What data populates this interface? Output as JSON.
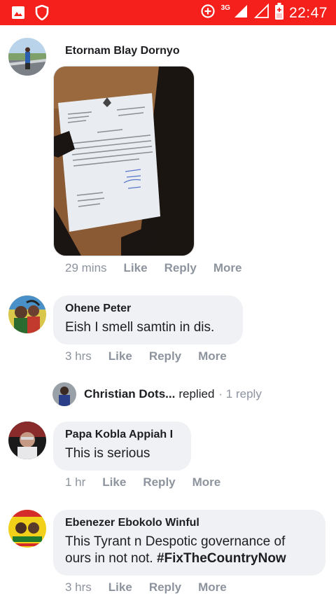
{
  "status_bar": {
    "time": "22:47",
    "network": "3G",
    "icons": [
      "image-icon",
      "shield-icon",
      "data-saver-icon",
      "signal-icon",
      "signal-empty-icon",
      "battery-charging-icon"
    ],
    "background_color": "#f5201c"
  },
  "comments": [
    {
      "author": "Etornam Blay Dornyo",
      "has_photo": true,
      "time": "29 mins",
      "like": "Like",
      "reply": "Reply",
      "more": "More"
    },
    {
      "author": "Ohene Peter",
      "text": "Eish I smell samtin in dis.",
      "time": "3 hrs",
      "like": "Like",
      "reply": "Reply",
      "more": "More"
    },
    {
      "author": "Papa Kobla Appiah I",
      "text": "This is serious",
      "time": "1 hr",
      "like": "Like",
      "reply": "Reply",
      "more": "More"
    },
    {
      "author": "Ebenezer Ebokolo Winful",
      "text": "This Tyrant n Despotic governance of ours in not not.",
      "hashtag": "#FixTheCountryNow",
      "time": "3 hrs",
      "like": "Like",
      "reply": "Reply",
      "more": "More"
    }
  ],
  "reply_preview": {
    "author": "Christian Dots...",
    "action": "replied",
    "count": "· 1 reply"
  }
}
